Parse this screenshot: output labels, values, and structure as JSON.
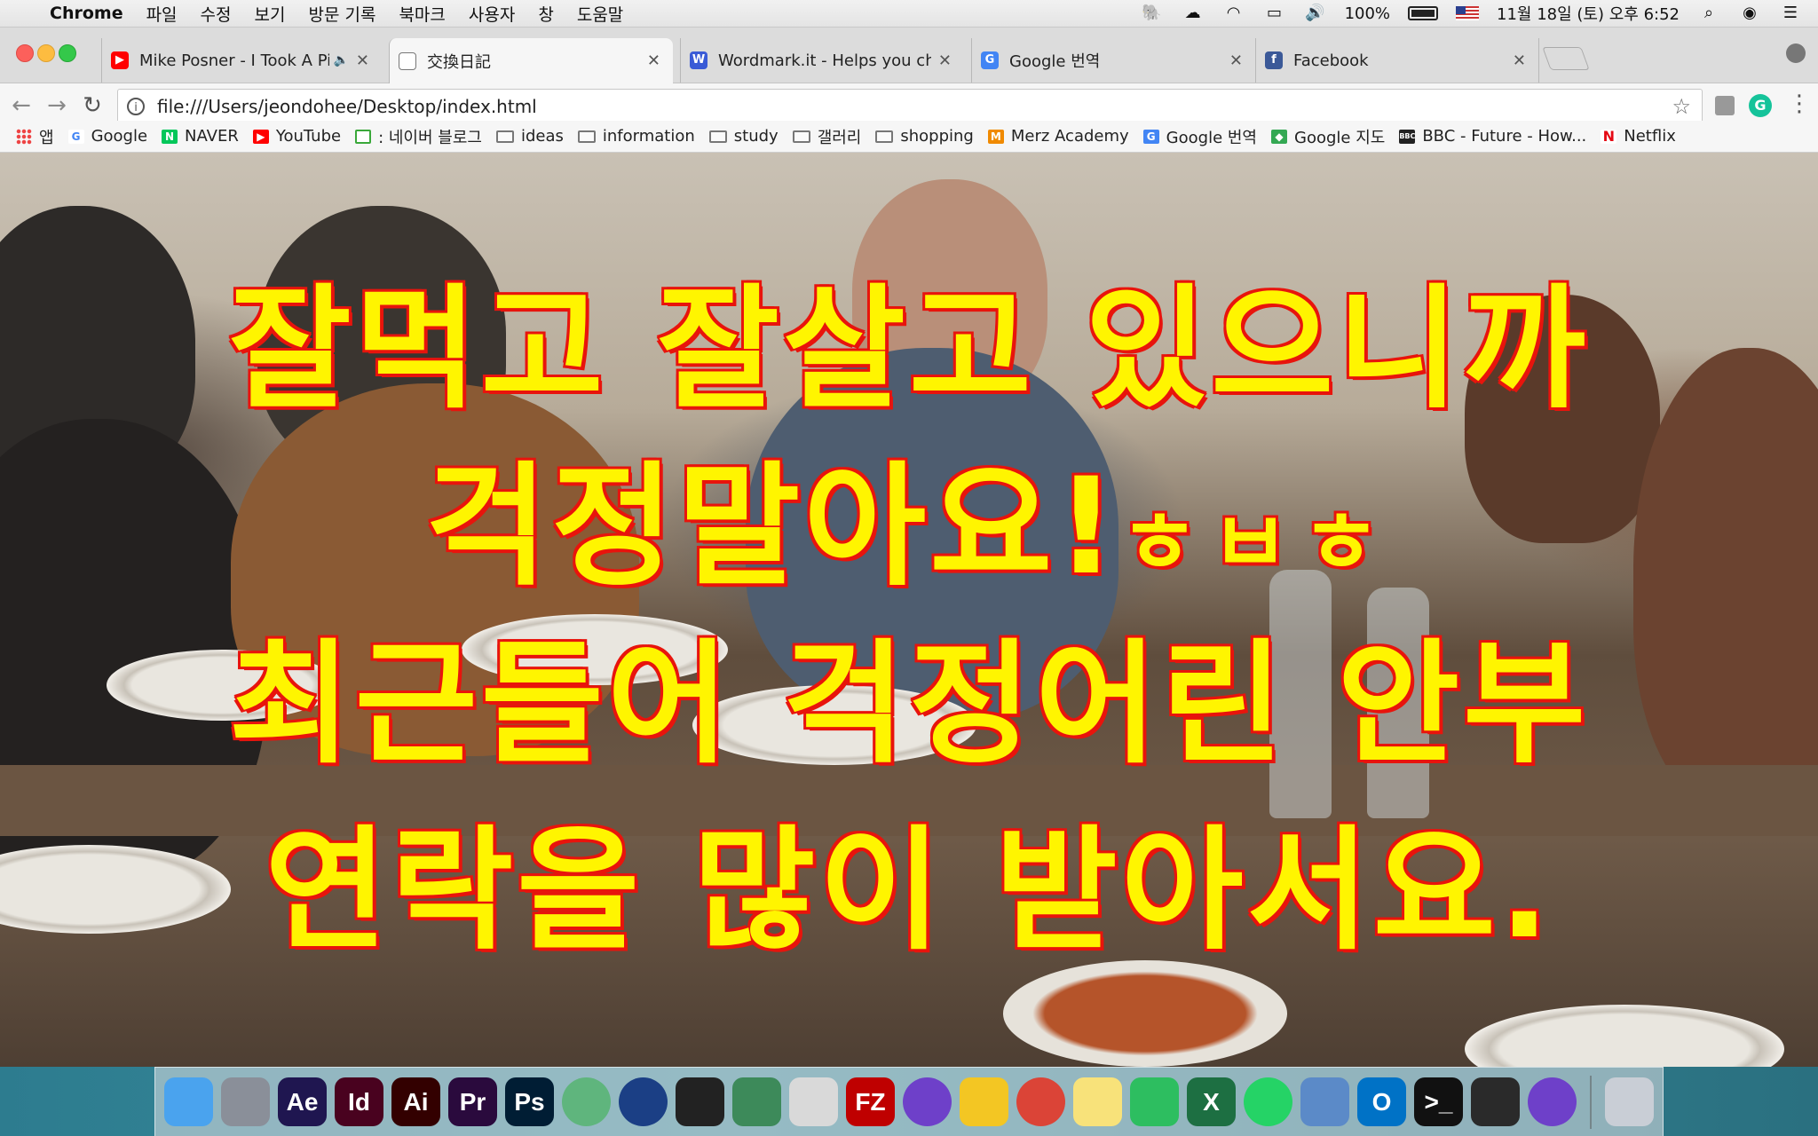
{
  "menubar": {
    "app_name": "Chrome",
    "menus": [
      "파일",
      "수정",
      "보기",
      "방문 기록",
      "북마크",
      "사용자",
      "창",
      "도움말"
    ],
    "battery": "100%",
    "datetime": "11월 18일 (토) 오후 6:52"
  },
  "tabs": [
    {
      "title": "Mike Posner - I Took A Pill In",
      "favicon": "youtube-icon",
      "color": "#ff0000",
      "active": false
    },
    {
      "title": "交換日記",
      "favicon": "page-icon",
      "color": "#ffffff",
      "active": true
    },
    {
      "title": "Wordmark.it - Helps you choose",
      "favicon": "wordmark-icon",
      "color": "#3a5bd6",
      "active": false
    },
    {
      "title": "Google 번역",
      "favicon": "google-translate-icon",
      "color": "#4285f4",
      "active": false
    },
    {
      "title": "Facebook",
      "favicon": "facebook-icon",
      "color": "#3b5998",
      "active": false
    }
  ],
  "omnibox": {
    "url": "file:///Users/jeondohee/Desktop/index.html"
  },
  "bookmarks": [
    {
      "label": "앱",
      "icon": "apps-grid-icon"
    },
    {
      "label": "Google",
      "icon": "google-icon"
    },
    {
      "label": "NAVER",
      "icon": "naver-icon"
    },
    {
      "label": "YouTube",
      "icon": "youtube-icon"
    },
    {
      "label": ": 네이버 블로그",
      "icon": "naver-blog-icon"
    },
    {
      "label": "ideas",
      "icon": "folder-icon"
    },
    {
      "label": "information",
      "icon": "folder-icon"
    },
    {
      "label": "study",
      "icon": "folder-icon"
    },
    {
      "label": "갤러리",
      "icon": "folder-icon"
    },
    {
      "label": "shopping",
      "icon": "folder-icon"
    },
    {
      "label": "Merz Academy",
      "icon": "merz-icon"
    },
    {
      "label": "Google 번역",
      "icon": "google-translate-icon"
    },
    {
      "label": "Google 지도",
      "icon": "google-maps-icon"
    },
    {
      "label": "BBC - Future - How...",
      "icon": "bbc-icon"
    },
    {
      "label": "Netflix",
      "icon": "netflix-icon"
    }
  ],
  "captions": {
    "line1": "잘먹고 잘살고 있으니까",
    "line2_main": "걱정말아요!",
    "line2_small": "ㅎㅂㅎ",
    "line3": "최근들어 걱정어린 안부",
    "line4": "연락을 많이 받아서요."
  },
  "dock": [
    {
      "name": "finder-icon",
      "label": "",
      "bg": "#4aa3ee"
    },
    {
      "name": "launchpad-icon",
      "label": "",
      "bg": "#8a8f99"
    },
    {
      "name": "after-effects-icon",
      "label": "Ae",
      "bg": "#1f1650"
    },
    {
      "name": "indesign-icon",
      "label": "Id",
      "bg": "#49021f"
    },
    {
      "name": "illustrator-icon",
      "label": "Ai",
      "bg": "#330000"
    },
    {
      "name": "premiere-icon",
      "label": "Pr",
      "bg": "#2a0a3d"
    },
    {
      "name": "photoshop-icon",
      "label": "Ps",
      "bg": "#001d34"
    },
    {
      "name": "atom-icon",
      "label": "",
      "bg": "#5fb57d"
    },
    {
      "name": "cinema4d-icon",
      "label": "",
      "bg": "#1b3f85"
    },
    {
      "name": "unity-icon",
      "label": "",
      "bg": "#222222"
    },
    {
      "name": "android-studio-icon",
      "label": "",
      "bg": "#3d8a5a"
    },
    {
      "name": "python-icon",
      "label": "",
      "bg": "#d9d9d9"
    },
    {
      "name": "filezilla-icon",
      "label": "FZ",
      "bg": "#bf0000"
    },
    {
      "name": "github-desktop-icon",
      "label": "",
      "bg": "#6e40c9"
    },
    {
      "name": "cyberduck-icon",
      "label": "",
      "bg": "#f3c623"
    },
    {
      "name": "chrome-icon",
      "label": "",
      "bg": "#db4437"
    },
    {
      "name": "notes-icon",
      "label": "",
      "bg": "#f8e27a"
    },
    {
      "name": "evernote-icon",
      "label": "",
      "bg": "#2dbe60"
    },
    {
      "name": "excel-icon",
      "label": "X",
      "bg": "#1d6f42"
    },
    {
      "name": "whatsapp-icon",
      "label": "",
      "bg": "#25d366"
    },
    {
      "name": "preview-icon",
      "label": "",
      "bg": "#5b8ac8"
    },
    {
      "name": "outlook-icon",
      "label": "O",
      "bg": "#0072c6"
    },
    {
      "name": "terminal-icon",
      "label": ">_",
      "bg": "#111111"
    },
    {
      "name": "acrobat-icon",
      "label": "",
      "bg": "#2a2a2a"
    },
    {
      "name": "github-icon",
      "label": "",
      "bg": "#6e40c9"
    },
    {
      "name": "trash-icon",
      "label": "",
      "bg": "#c9ced6"
    }
  ]
}
